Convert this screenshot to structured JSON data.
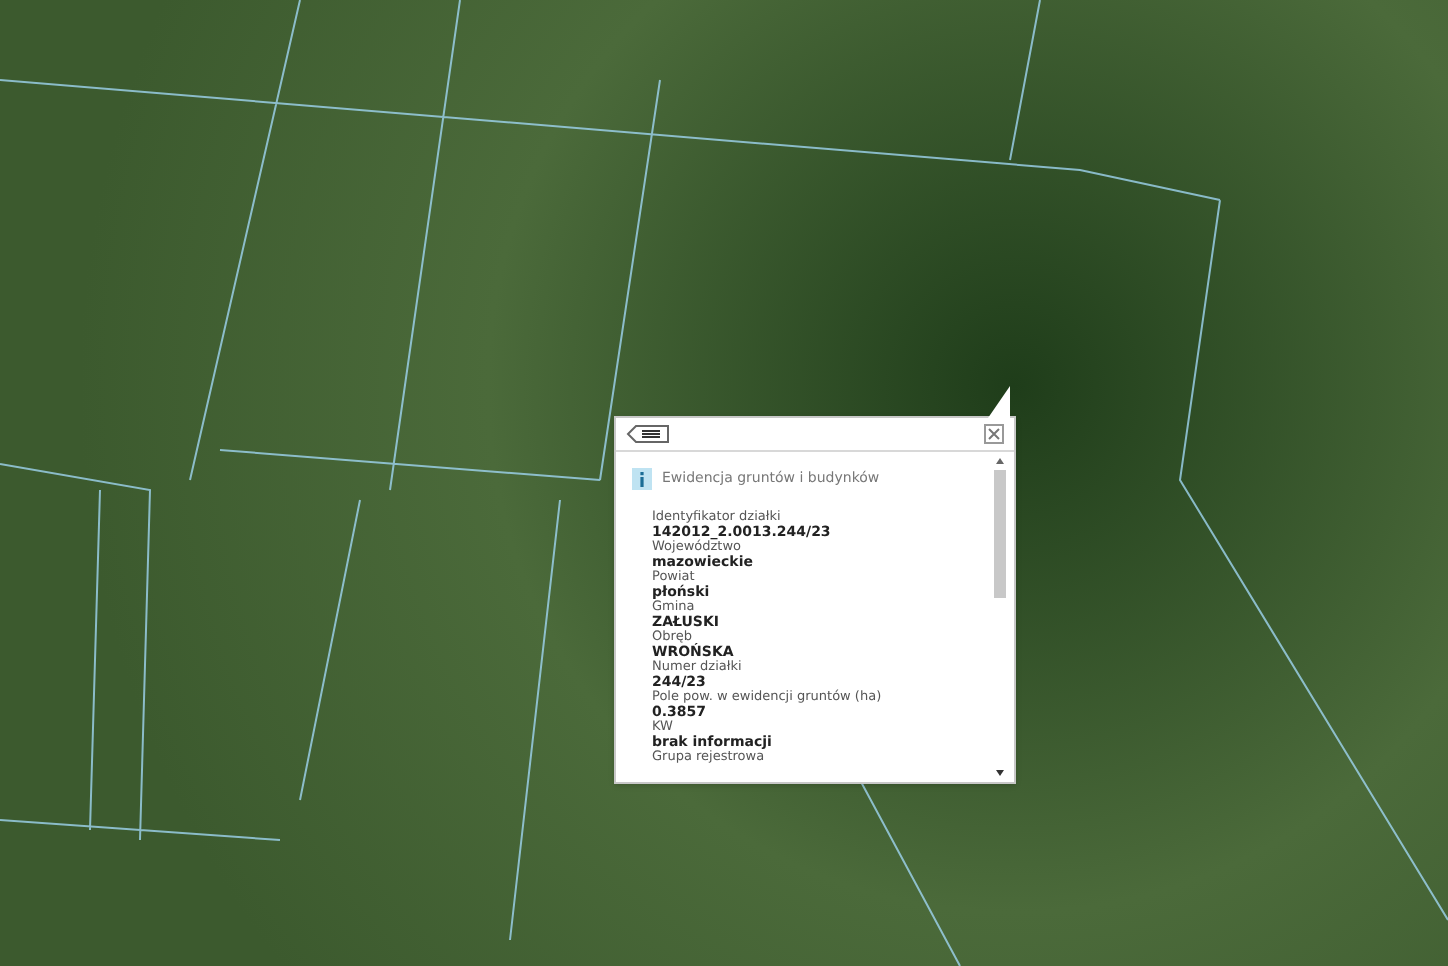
{
  "popup": {
    "header": "Ewidencja gruntów i budynków",
    "fields": [
      {
        "label": "Identyfikator działki",
        "value": "142012_2.0013.244/23"
      },
      {
        "label": "Województwo",
        "value": "mazowieckie"
      },
      {
        "label": "Powiat",
        "value": "płoński"
      },
      {
        "label": "Gmina",
        "value": "ZAŁUSKI"
      },
      {
        "label": "Obręb",
        "value": "WROŃSKA"
      },
      {
        "label": "Numer działki",
        "value": "244/23"
      },
      {
        "label": "Pole pow. w ewidencji gruntów (ha)",
        "value": "0.3857"
      },
      {
        "label": "KW",
        "value": "brak informacji"
      },
      {
        "label": "Grupa rejestrowa"
      }
    ]
  }
}
